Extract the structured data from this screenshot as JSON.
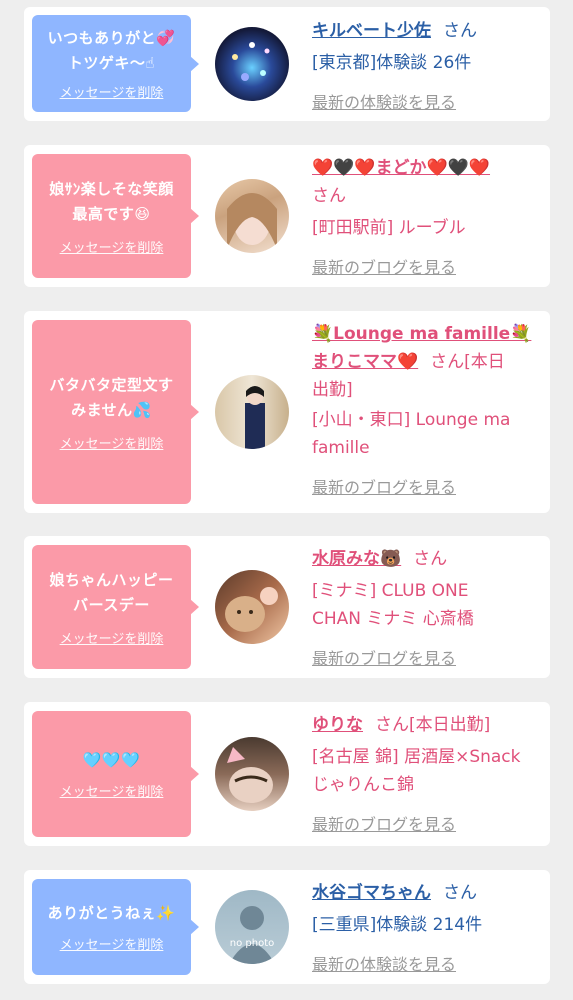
{
  "common": {
    "delete_label": "メッセージを削除",
    "san": "さん"
  },
  "cards": [
    {
      "message_line1": "いつもありがと💞",
      "message_line2": "トツゲキ〜☝",
      "name": "キルベート少佐",
      "location": "[東京都]体験談 26件",
      "link": "最新の体験談を見る"
    },
    {
      "message_line1": "娘ｻﾝ楽しそな笑顔",
      "message_line2": "最高です😆",
      "name": "❤️🖤❤️まどか❤️🖤❤️",
      "location": "[町田駅前] ルーブル",
      "link": "最新のブログを見る"
    },
    {
      "message_line1": "バタバタ定型文す",
      "message_line2": "みません💦",
      "name_line1": "💐Lounge ma famille💐",
      "name_line2": "まりこママ❤️",
      "suffix": "[本日",
      "suffix2": "出勤]",
      "location_line1": "[小山・東口] Lounge ma",
      "location_line2": "famille",
      "link": "最新のブログを見る"
    },
    {
      "message_line1": "娘ちゃんハッピー",
      "message_line2": "バースデー",
      "name": "水原みな🐻",
      "location_line1": "[ミナミ] CLUB ONE",
      "location_line2": "CHAN ミナミ 心斎橋",
      "link": "最新のブログを見る"
    },
    {
      "message_line1": "🩵🩵🩵",
      "name": "ゆりな",
      "suffix": "[本日出勤]",
      "location_line1": "[名古屋 錦] 居酒屋×Snack",
      "location_line2": "じゃりんこ錦",
      "link": "最新のブログを見る"
    },
    {
      "message_line1": "ありがとうねぇ✨",
      "name": "水谷ゴマちゃん",
      "location": "[三重県]体験談 214件",
      "link": "最新の体験談を見る",
      "avatar_text": "no photo"
    }
  ]
}
